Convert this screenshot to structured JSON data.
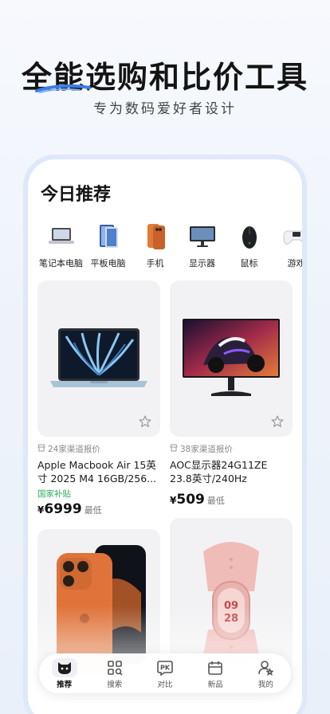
{
  "hero": {
    "title": "全能选购和比价工具",
    "subtitle": "专为数码爱好者设计"
  },
  "screen": {
    "title": "今日推荐"
  },
  "categories": [
    {
      "label": "笔记本电脑",
      "icon": "laptop-icon"
    },
    {
      "label": "平板电脑",
      "icon": "tablet-icon"
    },
    {
      "label": "手机",
      "icon": "phone-icon"
    },
    {
      "label": "显示器",
      "icon": "monitor-icon"
    },
    {
      "label": "鼠标",
      "icon": "mouse-icon"
    },
    {
      "label": "游戏",
      "icon": "gamepad-icon"
    }
  ],
  "products": [
    {
      "quotes": "24家渠道报价",
      "name": "Apple Macbook Air 15英寸 2025 M4 16GB/256...",
      "subsidy": "国家补贴",
      "currency": "¥",
      "price": "6999",
      "lowest": "最低"
    },
    {
      "quotes": "38家渠道报价",
      "name": "AOC显示器24G11ZE 23.8英寸/240Hz",
      "currency": "¥",
      "price": "509",
      "lowest": "最低"
    }
  ],
  "tabs": [
    {
      "label": "推荐",
      "icon": "cat-face-icon",
      "active": true
    },
    {
      "label": "搜索",
      "icon": "search-grid-icon"
    },
    {
      "label": "对比",
      "icon": "pk-icon"
    },
    {
      "label": "新品",
      "icon": "calendar-icon"
    },
    {
      "label": "我的",
      "icon": "profile-icon"
    }
  ],
  "colors": {
    "subsidy_green": "#2bab5a",
    "brand_blue": "#3a7de8",
    "phone_frame": "#dde8f8"
  }
}
